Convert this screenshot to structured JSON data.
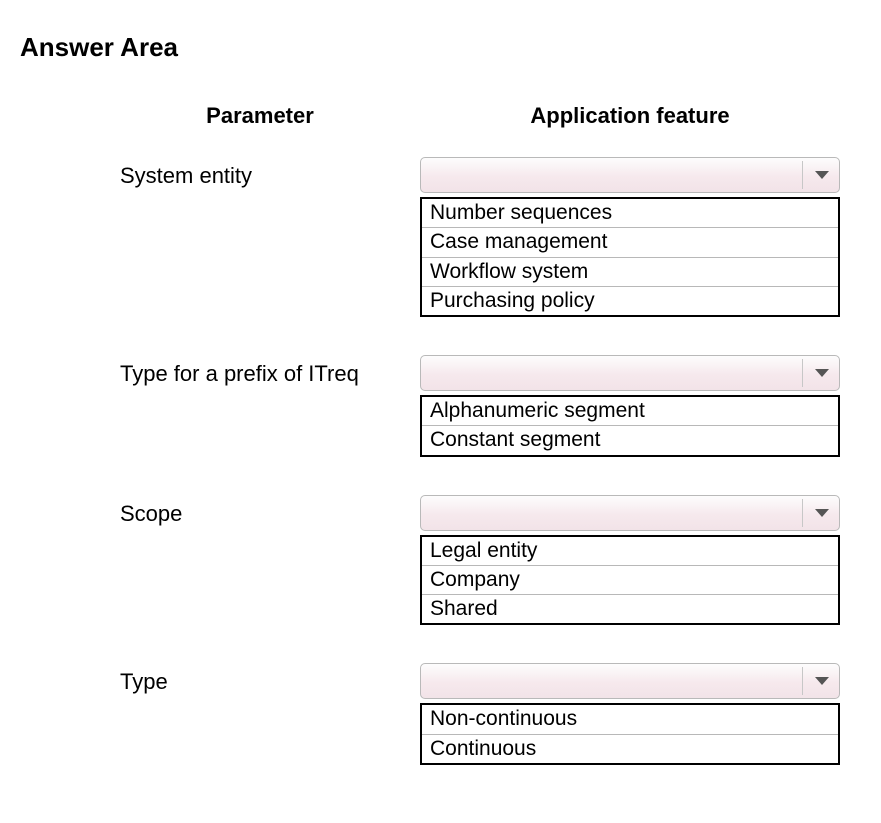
{
  "title": "Answer Area",
  "headers": {
    "parameter": "Parameter",
    "feature": "Application feature"
  },
  "rows": [
    {
      "label": "System entity",
      "options": [
        "Number sequences",
        "Case management",
        "Workflow system",
        "Purchasing policy"
      ]
    },
    {
      "label": "Type for a prefix of ITreq",
      "options": [
        "Alphanumeric segment",
        "Constant segment"
      ]
    },
    {
      "label": "Scope",
      "options": [
        "Legal entity",
        "Company",
        "Shared"
      ]
    },
    {
      "label": "Type",
      "options": [
        "Non-continuous",
        "Continuous"
      ]
    }
  ]
}
